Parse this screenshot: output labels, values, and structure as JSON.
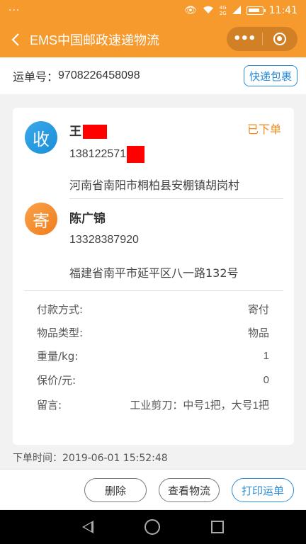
{
  "status_bar": {
    "left": "···",
    "net1": "4G",
    "net2": "2G",
    "time": "11:41"
  },
  "nav": {
    "title": "EMS中国邮政速递物流",
    "menu_dots": "•••"
  },
  "tracking": {
    "label": "运单号：",
    "number": "9708226458098",
    "express_button": "快递包裹"
  },
  "receiver": {
    "badge": "收",
    "name": "王",
    "phone": "138122571",
    "address": "河南省南阳市桐柏县安棚镇胡岗村"
  },
  "sender": {
    "badge": "寄",
    "name": "陈广锦",
    "phone": "13328387920",
    "address": "福建省南平市延平区八一路132号"
  },
  "order_status": "已下单",
  "details": [
    {
      "label": "付款方式:",
      "value": "寄付"
    },
    {
      "label": "物品类型:",
      "value": "物品"
    },
    {
      "label": "重量/kg:",
      "value": "1"
    },
    {
      "label": "保价/元:",
      "value": "0"
    },
    {
      "label": "留言:",
      "value": "工业剪刀：中号1把，大号1把"
    }
  ],
  "order_time": "下单时间：2019-06-01 15:52:48",
  "actions": {
    "delete": "删除",
    "view_logistics": "查看物流",
    "print": "打印运单"
  },
  "colors": {
    "brand_orange": "#f79a2e",
    "accent_blue": "#2b8bd6",
    "status_orange": "#f08a1c"
  }
}
